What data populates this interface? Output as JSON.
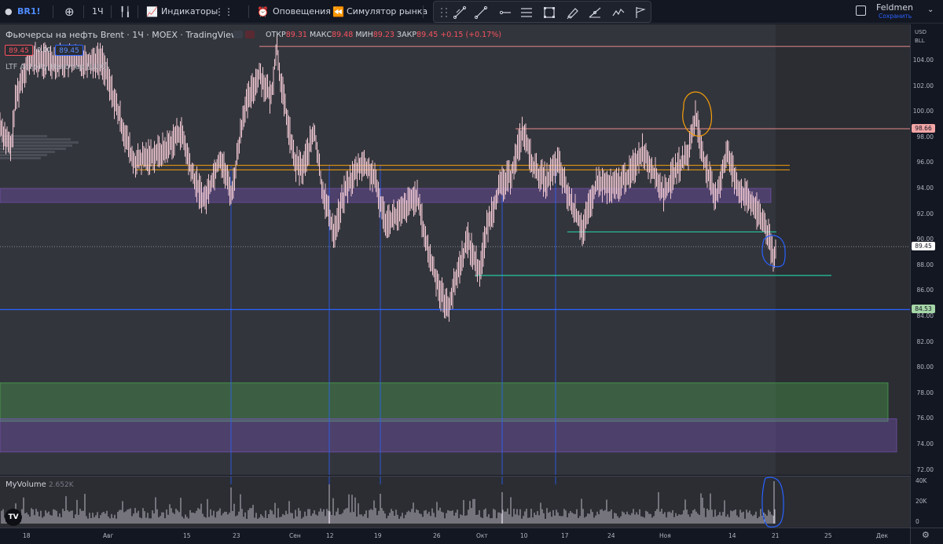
{
  "toolbar": {
    "symbol": "BR1!",
    "interval": "1Ч",
    "indicators_label": "Индикаторы",
    "alerts_label": "Оповещения",
    "replay_label": "Симулятор рынка",
    "user_name": "Feldmen",
    "save_label": "Сохранить"
  },
  "legend": {
    "title": "Фьючерсы на нефть Brent · 1Ч · MOEX · TradingView",
    "open_label": "ОТКР",
    "open": "89.31",
    "high_label": "МАКС",
    "high": "89.48",
    "low_label": "МИН",
    "low": "89.23",
    "close_label": "ЗАКР",
    "close": "89.45",
    "change": "+0.15 (+0.17%)",
    "sell_price": "89.45",
    "spread": "0.00",
    "buy_price": "89.45",
    "indicator_name": "LTF Activity Heatmap [LUX]"
  },
  "volume": {
    "name": "MyVolume",
    "value": "2.652K",
    "ticks": [
      "40K",
      "20K",
      "0"
    ]
  },
  "price_axis": {
    "currency": "USD",
    "unit": "BLL",
    "ticks": [
      "104.00",
      "102.00",
      "100.00",
      "98.00",
      "96.00",
      "94.00",
      "92.00",
      "90.00",
      "88.00",
      "86.00",
      "84.00",
      "82.00",
      "80.00",
      "78.00",
      "76.00",
      "74.00",
      "72.00"
    ],
    "labels": [
      {
        "text": "98.66",
        "price": 98.66,
        "color": "#f4a6a6"
      },
      {
        "text": "89.45",
        "price": 89.45,
        "color": "#ffffff"
      },
      {
        "text": "84.53",
        "price": 84.53,
        "color": "#a5d6a7"
      }
    ]
  },
  "time_axis": {
    "ticks": [
      "18",
      "Авг",
      "15",
      "23",
      "Сен",
      "12",
      "19",
      "26",
      "Окт",
      "10",
      "17",
      "24",
      "Ноя",
      "14",
      "21",
      "25",
      "Дек"
    ]
  },
  "colors": {
    "background": "#2b2d33",
    "candle": "#f0c8d2",
    "hline_blue": "#2962ff",
    "hline_orange": "#f59f0a",
    "hline_green": "#26c6a0",
    "zone_purple": "#7e57c2",
    "zone_green": "#4caf50",
    "annot_blue": "#2962ff",
    "annot_orange": "#f59f0a"
  }
}
